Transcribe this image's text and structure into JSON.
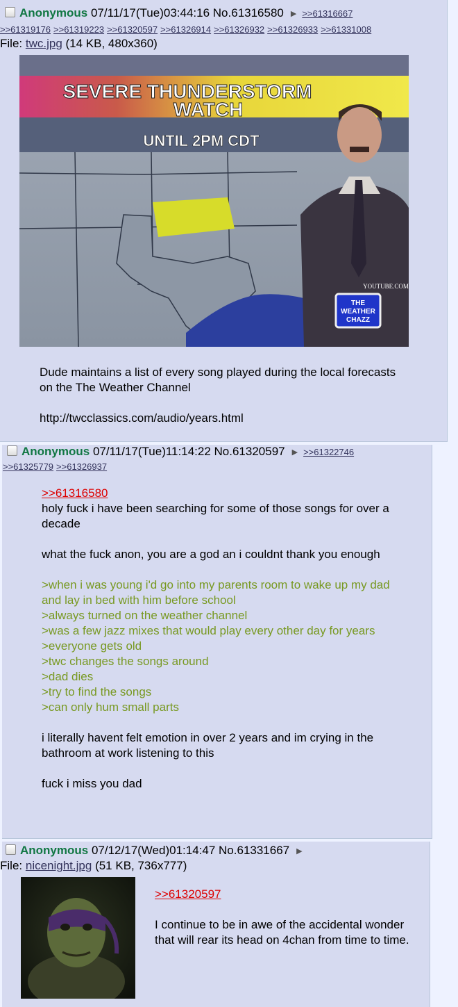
{
  "posts": [
    {
      "name": "Anonymous",
      "datetime": "07/11/17(Tue)03:44:16",
      "number": "No.61316580",
      "replies_first": ">>61316667",
      "replies": [
        ">>61319176",
        ">>61319223",
        ">>61320597",
        ">>61326914",
        ">>61326932",
        ">>61326933",
        ">>61331008"
      ],
      "file_label": "File:",
      "file_name": "twc.jpg",
      "file_info": "(14 KB, 480x360)",
      "image": {
        "headline1": "SEVERE THUNDERSTORM",
        "headline2": "WATCH",
        "until": "UNTIL 2PM CDT",
        "watermark": "YOUTUBE.COM",
        "logo1": "THE",
        "logo2": "WEATHER",
        "logo3": "CHAZZ"
      },
      "lines": [
        "Dude maintains a list of every song played during the local forecasts on the The Weather Channel",
        "http://twcclassics.com/audio/years.html"
      ]
    },
    {
      "name": "Anonymous",
      "datetime": "07/11/17(Tue)11:14:22",
      "number": "No.61320597",
      "replies_first": ">>61322746",
      "replies": [
        ">>61325779",
        ">>61326937"
      ],
      "quote_link": ">>61316580",
      "text1": "holy fuck i have been searching for some of those songs for over a decade",
      "text2": "what the fuck anon, you are a god an i couldnt thank you enough",
      "greentext": [
        ">when i was young i'd go into my parents room to wake up my dad and lay in bed with him before school",
        ">always turned on the weather channel",
        ">was a few jazz mixes that would play every other day for years",
        ">everyone gets old",
        ">twc changes the songs around",
        ">dad dies",
        ">try to find the songs",
        ">can only hum small parts"
      ],
      "text3": "i literally havent felt emotion in over 2 years and im crying in the bathroom at work listening to this",
      "text4": "fuck i miss you dad"
    },
    {
      "name": "Anonymous",
      "datetime": "07/12/17(Wed)01:14:47",
      "number": "No.61331667",
      "file_label": "File:",
      "file_name": "nicenight.jpg",
      "file_info": "(51 KB, 736x777)",
      "quote_link": ">>61320597",
      "text1": "I continue to be in awe of the accidental wonder that will rear its head on 4chan from time to time."
    }
  ],
  "colors": {
    "page_bg": "#eef2ff",
    "post_bg": "#d6daf0",
    "name": "#117743",
    "link": "#34345c",
    "quotelink": "#dd0000",
    "greentext": "#789922"
  },
  "icons": {
    "checkbox": "checkbox-icon",
    "menu": "post-menu-arrow-icon"
  }
}
